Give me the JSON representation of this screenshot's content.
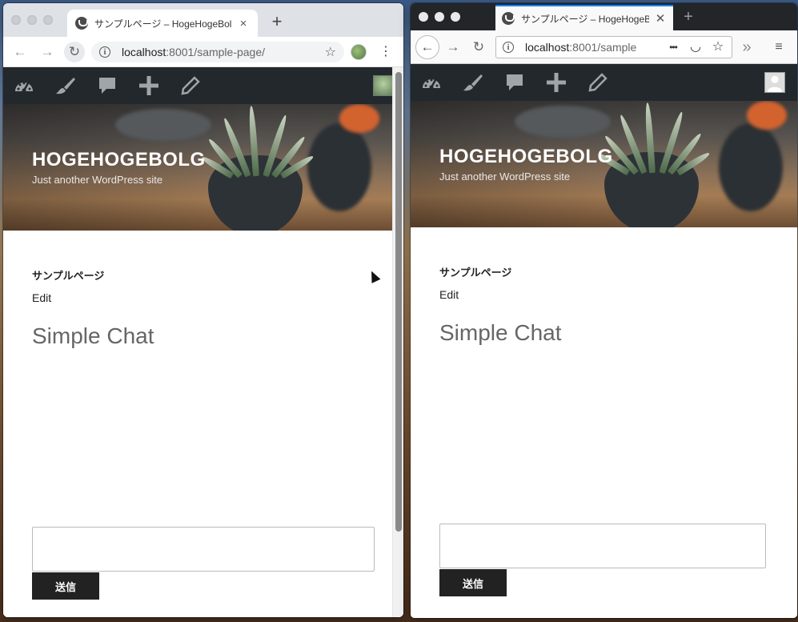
{
  "chrome": {
    "tab_title": "サンプルページ – HogeHogeBolg",
    "close_glyph": "×",
    "newtab_glyph": "+",
    "url_host": "localhost",
    "url_rest": ":8001/sample-page/",
    "back_glyph": "←",
    "forward_glyph": "→",
    "reload_glyph": "↻",
    "star_glyph": "☆",
    "menu_glyph": "⋮",
    "info_glyph": "i"
  },
  "firefox": {
    "tab_title": "サンプルページ – HogeHogeBolg",
    "close_glyph": "✕",
    "newtab_glyph": "+",
    "url_host": "localhost",
    "url_rest": ":8001/sample",
    "back_glyph": "←",
    "forward_glyph": "→",
    "reload_glyph": "↻",
    "more_glyph": "•••",
    "pocket_glyph": "◡",
    "star_glyph": "☆",
    "overflow_glyph": "»",
    "menu_glyph": "≡",
    "info_glyph": "i"
  },
  "site": {
    "title": "HOGEHOGEBOLG",
    "tagline": "Just another WordPress site",
    "page_title": "サンプルページ",
    "edit_label": "Edit",
    "chat_heading": "Simple Chat",
    "send_label": "送信"
  },
  "adminbar": {
    "icons": [
      "dashboard-icon",
      "customize-brush-icon",
      "comments-icon",
      "new-content-icon",
      "edit-pencil-icon"
    ]
  },
  "colors": {
    "admin_bar": "#23282d",
    "send_button": "#222222",
    "firefox_accent": "#0a84ff"
  }
}
